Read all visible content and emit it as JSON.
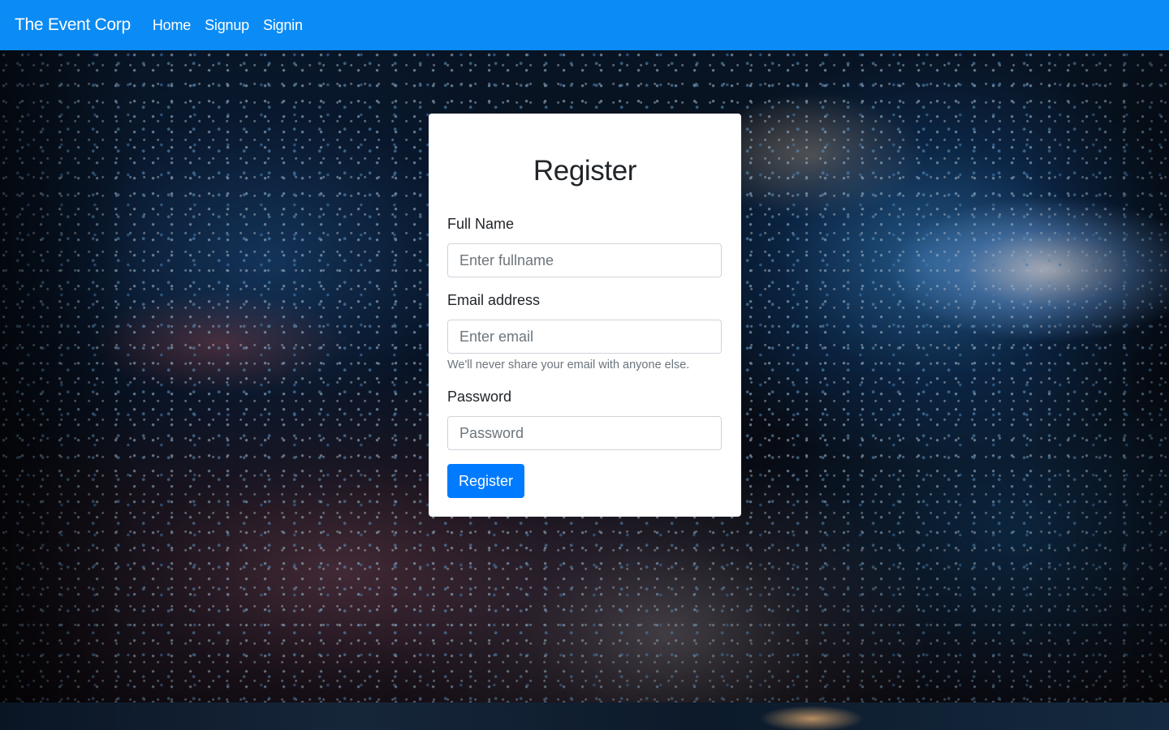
{
  "navbar": {
    "brand": "The Event Corp",
    "links": [
      "Home",
      "Signup",
      "Signin"
    ],
    "color": "#0a8bf5"
  },
  "form": {
    "title": "Register",
    "fullname": {
      "label": "Full Name",
      "placeholder": "Enter fullname",
      "value": ""
    },
    "email": {
      "label": "Email address",
      "placeholder": "Enter email",
      "value": "",
      "help": "We'll never share your email with anyone else."
    },
    "password": {
      "label": "Password",
      "placeholder": "Password",
      "value": ""
    },
    "submit_label": "Register",
    "submit_color": "#007bff"
  },
  "background": {
    "image": "concert-crowd-confetti-photo"
  }
}
